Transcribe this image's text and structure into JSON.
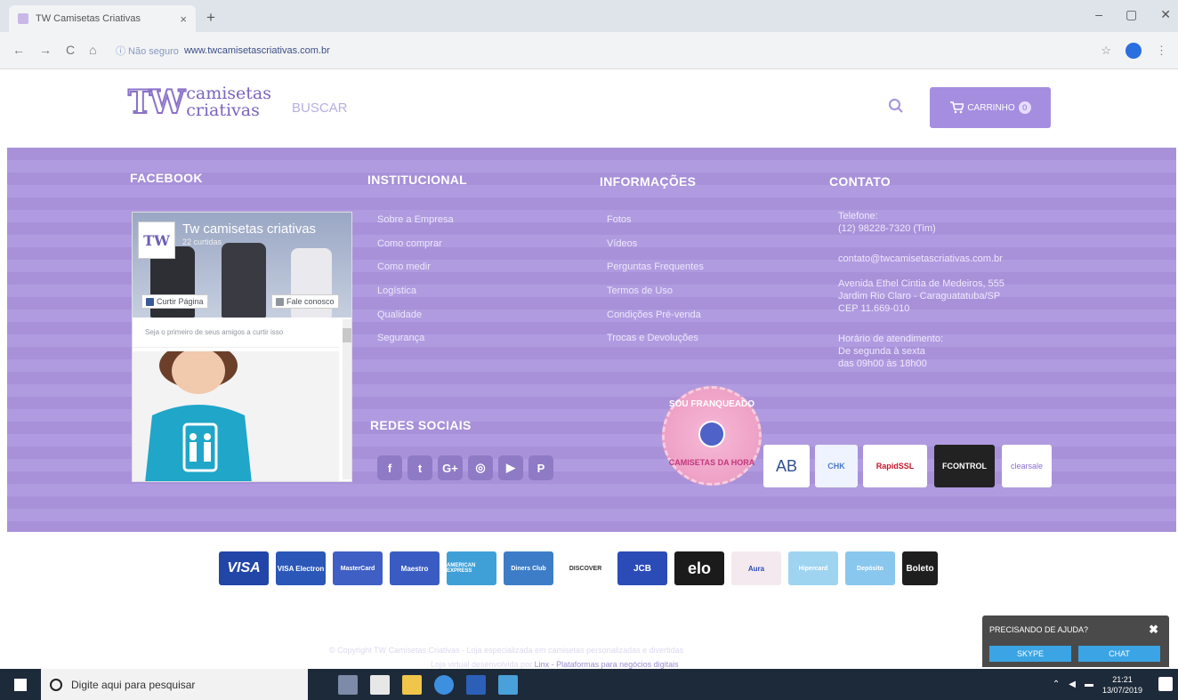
{
  "browser": {
    "tab_title": "TW Camisetas Criativas",
    "tab_close": "×",
    "new_tab": "+",
    "min": "–",
    "max": "▢",
    "close": "✕",
    "back": "←",
    "forward": "→",
    "reload": "C",
    "home": "⌂",
    "insecure": "ⓘ Não seguro",
    "url": "www.twcamisetascriativas.com.br",
    "star": "☆",
    "menu": "⋮"
  },
  "header": {
    "logo_tw": "TW",
    "logo_line1": "camisetas",
    "logo_line2": "criativas",
    "search_placeholder": "BUSCAR",
    "cart_label": "CARRINHO",
    "cart_count": "0"
  },
  "footer": {
    "facebook_title": "FACEBOOK",
    "institucional_title": "INSTITUCIONAL",
    "informacoes_title": "INFORMAÇÕES",
    "contato_title": "CONTATO",
    "institucional": [
      "Sobre a Empresa",
      "Como comprar",
      "Como medir",
      "Logística",
      "Qualidade",
      "Segurança"
    ],
    "informacoes": [
      "Fotos",
      "Vídeos",
      "Perguntas Frequentes",
      "Termos de Uso",
      "Condições Pré-venda",
      "Trocas e Devoluções"
    ],
    "contato": {
      "phone_label": "Telefone:",
      "phone": "(12) 98228-7320 (Tim)",
      "email": "contato@twcamisetascriativas.com.br",
      "address1": "Avenida Ethel Cintia de Medeiros, 555",
      "address2": "Jardim Rio Claro - Caraguatatuba/SP",
      "address3": "CEP 11.669-010",
      "hours_label": "Horário de atendimento:",
      "hours1": "De segunda à sexta",
      "hours2": "das 09h00 às 18h00"
    },
    "redes_title": "REDES SOCIAIS",
    "social": [
      "f",
      "t",
      "G+",
      "◎",
      "▶",
      "P"
    ],
    "franquia_top": "SOU FRANQUEADO",
    "franquia_bottom": "CAMISETAS DA HORA",
    "seals": [
      "AB",
      "CHK",
      "RapidSSL",
      "FCONTROL",
      "clearsale"
    ]
  },
  "facebook_widget": {
    "avatar": "TW",
    "page_name": "Tw camisetas criativas",
    "likes": "22 curtidas",
    "like_button": "Curtir Página",
    "contact_button": "Fale conosco",
    "friends_text": "Seja o primeiro de seus amigos a curtir isso"
  },
  "payments": [
    "VISA",
    "VISA Electron",
    "MasterCard",
    "Maestro",
    "AMERICAN EXPRESS",
    "Diners Club",
    "DISCOVER",
    "JCB",
    "elo",
    "Aura",
    "Hipercard",
    "Depósito",
    "Boleto"
  ],
  "copyright": "© Copyright TW Camisetas Criativas - Loja especializada em camisetas personalizadas e divertidas",
  "loja_virtual": "Loja virtual desenvolvida por",
  "linx": "Linx - Plataformas para negócios digitais",
  "help": {
    "title": "PRECISANDO DE AJUDA?",
    "close": "✖",
    "skype": "SKYPE",
    "chat": "CHAT"
  },
  "taskbar": {
    "search": "Digite aqui para pesquisar",
    "time": "21:21",
    "date": "13/07/2019"
  }
}
